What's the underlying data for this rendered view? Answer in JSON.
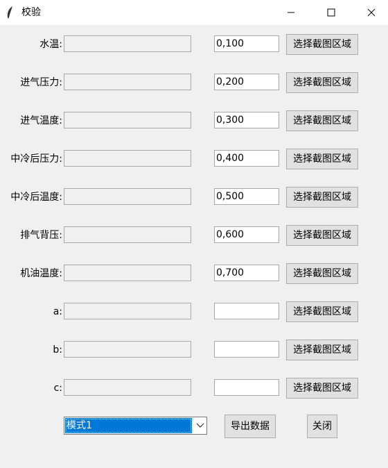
{
  "window": {
    "title": "校验",
    "icons": {
      "app": "feather-icon",
      "minimize": "minimize-icon",
      "maximize": "maximize-icon",
      "close": "close-icon"
    }
  },
  "rows": [
    {
      "label": "水温:",
      "value": "0,100",
      "button": "选择截图区域"
    },
    {
      "label": "进气压力:",
      "value": "0,200",
      "button": "选择截图区域"
    },
    {
      "label": "进气温度:",
      "value": "0,300",
      "button": "选择截图区域"
    },
    {
      "label": "中冷后压力:",
      "value": "0,400",
      "button": "选择截图区域"
    },
    {
      "label": "中冷后温度:",
      "value": "0,500",
      "button": "选择截图区域"
    },
    {
      "label": "排气背压:",
      "value": "0,600",
      "button": "选择截图区域"
    },
    {
      "label": "机油温度:",
      "value": "0,700",
      "button": "选择截图区域"
    },
    {
      "label": "a:",
      "value": "",
      "button": "选择截图区域"
    },
    {
      "label": "b:",
      "value": "",
      "button": "选择截图区域"
    },
    {
      "label": "c:",
      "value": "",
      "button": "选择截图区域"
    }
  ],
  "footer": {
    "mode_selected": "模式1",
    "export_label": "导出数据",
    "close_label": "关闭"
  },
  "colors": {
    "window_bg": "#f0f0f0",
    "titlebar_bg": "#ffffff",
    "selection_bg": "#0078d7",
    "button_bg": "#e1e1e1"
  }
}
